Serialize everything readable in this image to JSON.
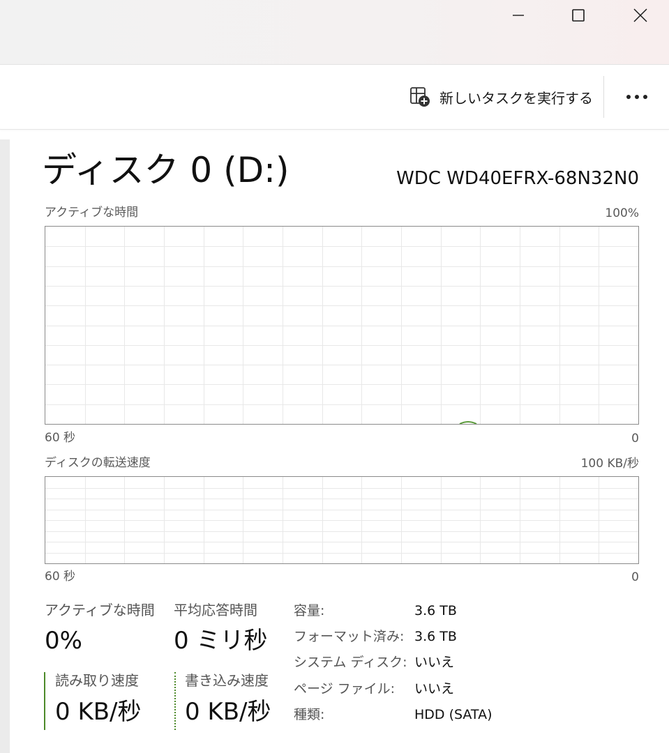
{
  "window": {
    "controls": {
      "minimize_icon": "minimize-icon",
      "maximize_icon": "maximize-icon",
      "close_icon": "close-icon"
    }
  },
  "toolbar": {
    "run_task_label": "新しいタスクを実行する",
    "run_task_icon": "new-task-icon",
    "more_icon": "more-icon"
  },
  "disk": {
    "title": "ディスク 0 (D:)",
    "model": "WDC WD40EFRX-68N32N0"
  },
  "graphs": {
    "active_time": {
      "label": "アクティブな時間",
      "max_label": "100%",
      "time_label": "60 秒",
      "min_label": "0"
    },
    "transfer_rate": {
      "label": "ディスクの転送速度",
      "max_label": "100 KB/秒",
      "time_label": "60 秒",
      "min_label": "0"
    }
  },
  "stats": {
    "active_time_label": "アクティブな時間",
    "active_time_value": "0%",
    "avg_response_label": "平均応答時間",
    "avg_response_value": "0 ミリ秒",
    "read_speed_label": "読み取り速度",
    "read_speed_value": "0 KB/秒",
    "write_speed_label": "書き込み速度",
    "write_speed_value": "0 KB/秒"
  },
  "info": {
    "capacity_label": "容量:",
    "capacity_value": "3.6 TB",
    "formatted_label": "フォーマット済み:",
    "formatted_value": "3.6 TB",
    "system_disk_label": "システム ディスク:",
    "system_disk_value": "いいえ",
    "page_file_label": "ページ ファイル:",
    "page_file_value": "いいえ",
    "type_label": "種類:",
    "type_value": "HDD (SATA)"
  },
  "colors": {
    "graph_border": "#8a8a8a",
    "grid_line": "#e8e8e8",
    "activity_green": "#5a9a3a",
    "read_line": "#4d8a2a"
  }
}
